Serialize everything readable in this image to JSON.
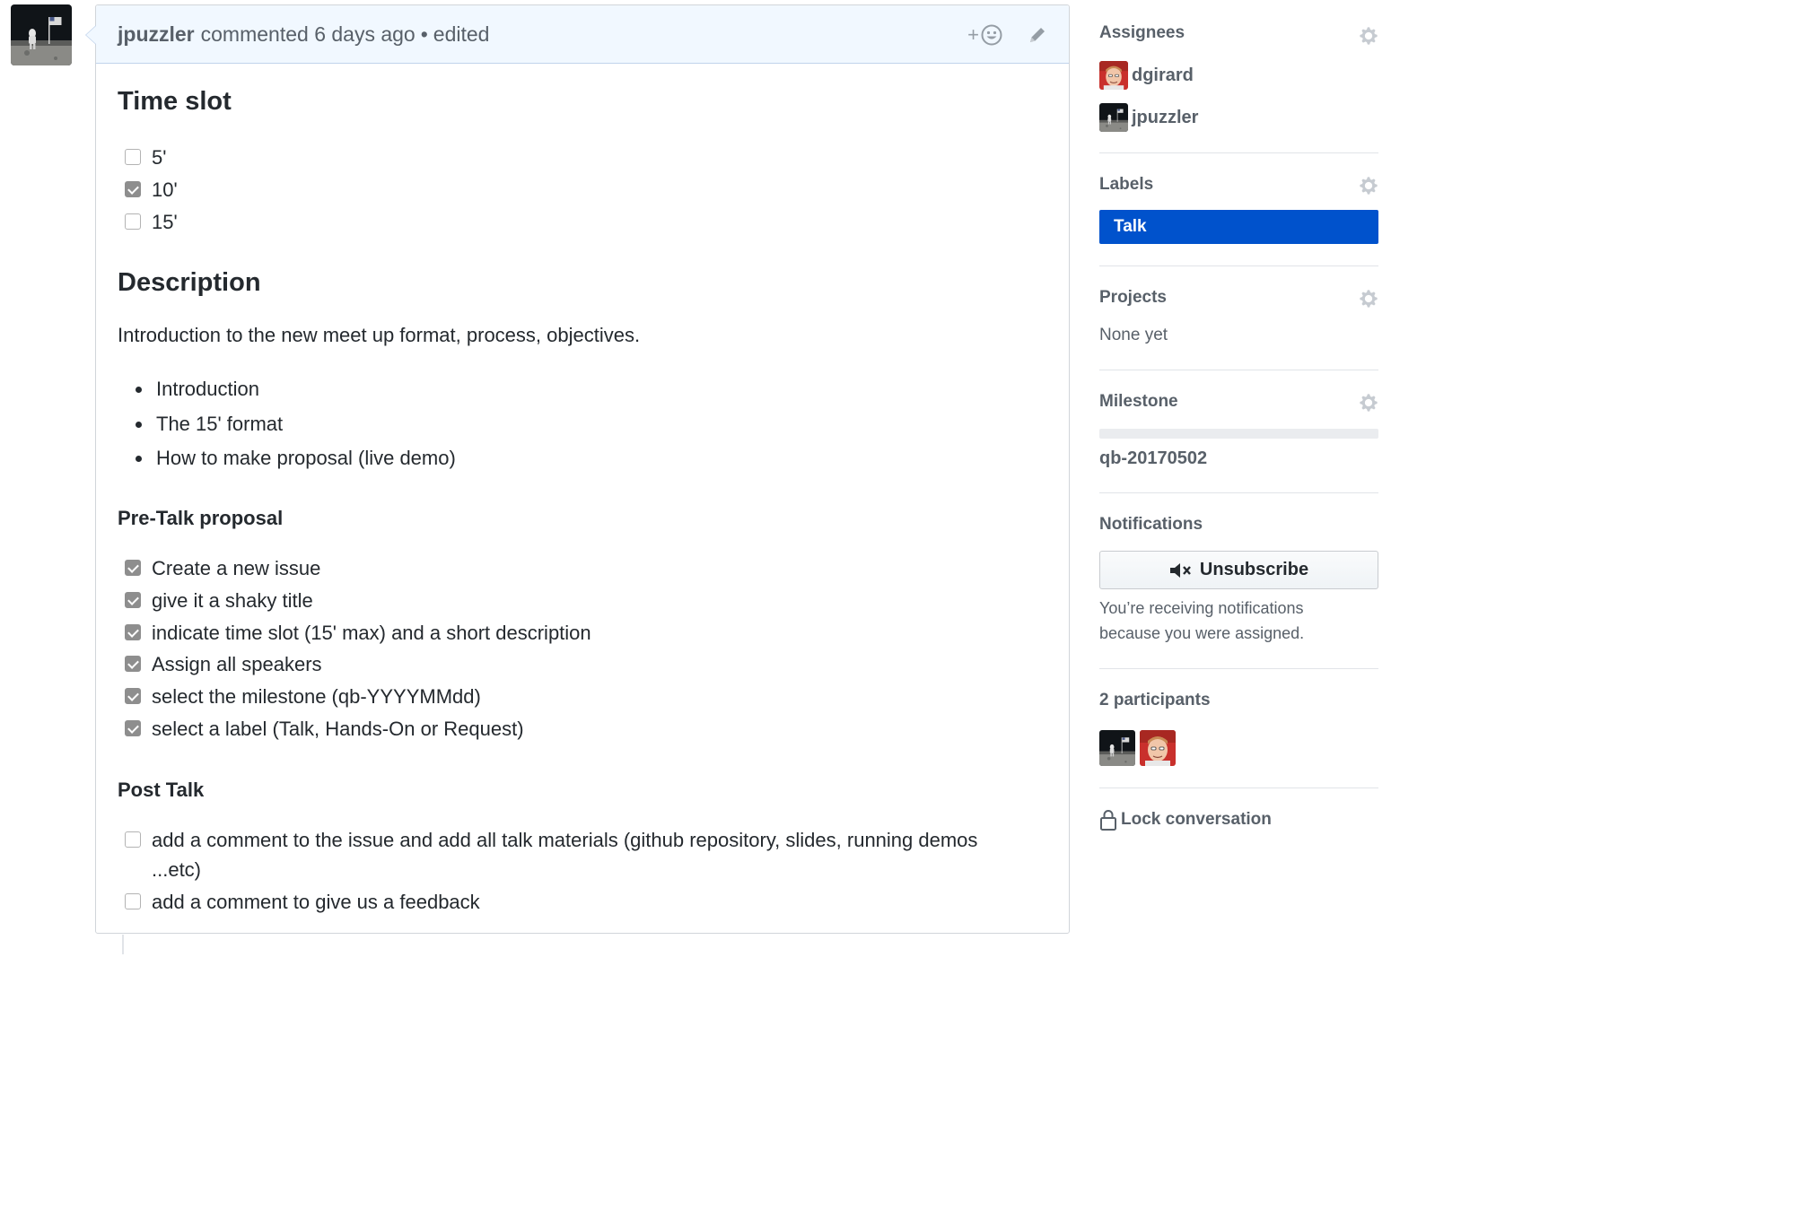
{
  "comment": {
    "author": "jpuzzler",
    "action": "commented",
    "time": "6 days ago",
    "separator": "•",
    "edited": "edited",
    "reaction_plus": "+"
  },
  "body": {
    "time_slot_heading": "Time slot",
    "time_slots": [
      {
        "label": "5'",
        "checked": false
      },
      {
        "label": "10'",
        "checked": true
      },
      {
        "label": "15'",
        "checked": false
      }
    ],
    "description_heading": "Description",
    "description_text": "Introduction to the new meet up format, process, objectives.",
    "bullets": [
      "Introduction",
      "The 15' format",
      "How to make proposal (live demo)"
    ],
    "pretalk_heading": "Pre-Talk proposal",
    "pretalk_tasks": [
      {
        "label": "Create a new issue",
        "checked": true
      },
      {
        "label": "give it a shaky title",
        "checked": true
      },
      {
        "label": "indicate time slot (15' max) and a short description",
        "checked": true
      },
      {
        "label": "Assign all speakers",
        "checked": true
      },
      {
        "label": "select the milestone (qb-YYYYMMdd)",
        "checked": true
      },
      {
        "label": "select a label (Talk, Hands-On or Request)",
        "checked": true
      }
    ],
    "posttalk_heading": "Post Talk",
    "posttalk_tasks": [
      {
        "label": "add a comment to the issue and add all talk materials (github repository, slides, running demos ...etc)",
        "checked": false
      },
      {
        "label": "add a comment to give us a feedback",
        "checked": false
      }
    ]
  },
  "sidebar": {
    "assignees_title": "Assignees",
    "assignees": [
      "dgirard",
      "jpuzzler"
    ],
    "labels_title": "Labels",
    "label": "Talk",
    "label_color": "#0052cc",
    "projects_title": "Projects",
    "projects_value": "None yet",
    "milestone_title": "Milestone",
    "milestone_progress": 0,
    "milestone_name": "qb-20170502",
    "notifications_title": "Notifications",
    "unsubscribe_label": "Unsubscribe",
    "notif_reason": "You’re receiving notifications because you were assigned.",
    "participants_title": "2 participants",
    "lock_label": "Lock conversation"
  },
  "icons": {
    "gear": "gear-icon",
    "smiley": "smiley-icon",
    "pencil": "pencil-icon",
    "mute": "mute-icon",
    "lock": "lock-icon"
  }
}
